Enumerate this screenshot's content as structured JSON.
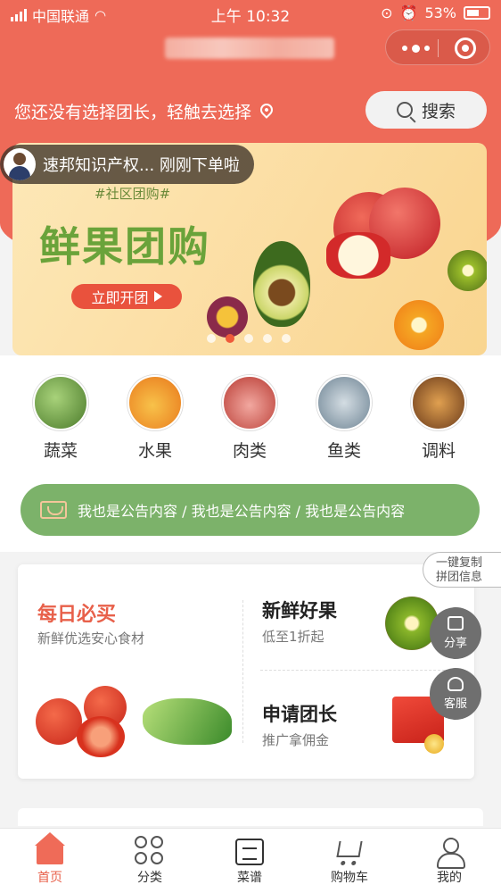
{
  "status_bar": {
    "carrier": "中国联通",
    "time": "上午 10:32",
    "battery": "53%"
  },
  "nav": {
    "title": "",
    "more_icon": "more-dots-icon",
    "close_icon": "target-circle-icon"
  },
  "leader": {
    "prompt": "您还没有选择团长，轻触去选择",
    "search_label": "搜索"
  },
  "ticker": {
    "text": "速邦知识产权... 刚刚下单啦"
  },
  "banner": {
    "tag": "#社区团购#",
    "headline": "鲜果团购",
    "cta": "立即开团",
    "slide_count": 5,
    "active_slide": 2
  },
  "categories": [
    {
      "label": "蔬菜",
      "color": "#6aa04a"
    },
    {
      "label": "水果",
      "color": "#f39a2a"
    },
    {
      "label": "肉类",
      "color": "#c9574a"
    },
    {
      "label": "鱼类",
      "color": "#8aa0b0"
    },
    {
      "label": "调料",
      "color": "#9a5a2a"
    }
  ],
  "notice": {
    "text": "我也是公告内容 / 我也是公告内容 / 我也是公告内容"
  },
  "promo": {
    "daily": {
      "title": "每日必买",
      "subtitle": "新鲜优选安心食材"
    },
    "fresh": {
      "title": "新鲜好果",
      "subtitle": "低至1折起"
    },
    "leader": {
      "title": "申请团长",
      "subtitle": "推广拿佣金"
    }
  },
  "floating": {
    "copy_line1": "一键复制",
    "copy_line2": "拼团信息",
    "share": "分享",
    "service": "客服"
  },
  "tabbar": [
    {
      "label": "首页",
      "active": true
    },
    {
      "label": "分类",
      "active": false
    },
    {
      "label": "菜谱",
      "active": false
    },
    {
      "label": "购物车",
      "active": false
    },
    {
      "label": "我的",
      "active": false
    }
  ],
  "colors": {
    "brand": "#ee6a58",
    "notice": "#7cb26a",
    "accent_text": "#e8604a"
  }
}
